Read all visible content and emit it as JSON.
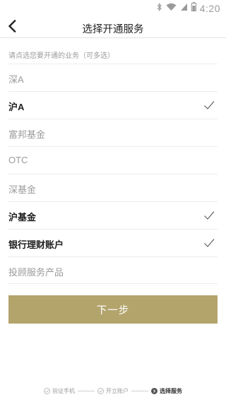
{
  "status": {
    "time": "4:20",
    "icons": [
      "bluetooth-icon",
      "wifi-icon",
      "signal-icon",
      "battery-icon"
    ]
  },
  "nav": {
    "title": "选择开通服务",
    "back_icon": "chevron-left-icon"
  },
  "hint": "请点选您要开通的业务（可多选）",
  "services": [
    {
      "label": "深A",
      "selected": false
    },
    {
      "label": "沪A",
      "selected": true
    },
    {
      "label": "富邦基金",
      "selected": false
    },
    {
      "label": "OTC",
      "selected": false
    },
    {
      "label": "深基金",
      "selected": false
    },
    {
      "label": "沪基金",
      "selected": true
    },
    {
      "label": "银行理财账户",
      "selected": true
    },
    {
      "label": "投顾服务产品",
      "selected": false
    }
  ],
  "next_button": "下一步",
  "steps": [
    {
      "label": "验证手机",
      "state": "done"
    },
    {
      "label": "开立账户",
      "state": "done"
    },
    {
      "label": "选择服务",
      "state": "active"
    }
  ],
  "colors": {
    "accent": "#b3a46c",
    "muted_text": "#9b9b9b",
    "selected_text": "#1e1e1e"
  }
}
